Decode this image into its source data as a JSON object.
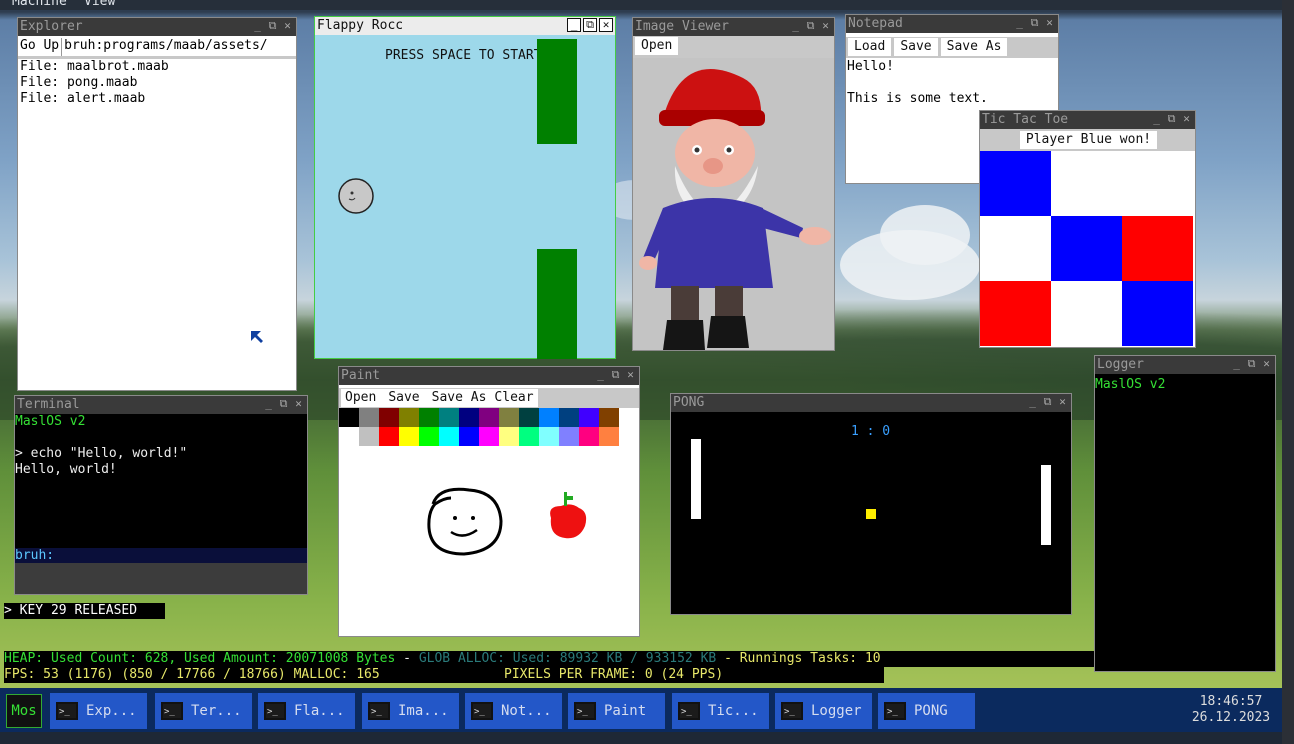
{
  "menu": {
    "machine": "Machine",
    "view": "View"
  },
  "explorer": {
    "title": "Explorer",
    "go_up": "Go Up",
    "path": "bruh:programs/maab/assets/",
    "files": [
      "File: maalbrot.maab",
      "File: pong.maab",
      "File: alert.maab"
    ]
  },
  "flappy": {
    "title": "Flappy Rocc",
    "prompt": "PRESS SPACE TO START"
  },
  "image_viewer": {
    "title": "Image Viewer",
    "open": "Open"
  },
  "notepad": {
    "title": "Notepad",
    "load": "Load",
    "save": "Save",
    "save_as": "Save As",
    "line1": "Hello!",
    "line2": "This is some text."
  },
  "tictactoe": {
    "title": "Tic Tac Toe",
    "status": "Player Blue won!",
    "board": [
      "blue",
      "white",
      "white",
      "white",
      "blue",
      "red",
      "red",
      "white",
      "blue"
    ],
    "colors": {
      "blue": "#0000ff",
      "red": "#ff0000",
      "white": "#ffffff"
    }
  },
  "terminal": {
    "title": "Terminal",
    "header": "MaslOS v2",
    "command": "> echo \"Hello, world!\"",
    "output": "Hello, world!",
    "prompt": "bruh:"
  },
  "key_event": "> KEY 29 RELEASED",
  "paint": {
    "title": "Paint",
    "open": "Open",
    "save": "Save",
    "save_as": "Save As",
    "clear": "Clear",
    "palette_row1": [
      "#000000",
      "#808080",
      "#800000",
      "#808000",
      "#008000",
      "#008080",
      "#000080",
      "#800080",
      "#808040",
      "#004040",
      "#0080ff",
      "#004080",
      "#4000ff",
      "#804000"
    ],
    "palette_row2": [
      "#ffffff",
      "#c0c0c0",
      "#ff0000",
      "#ffff00",
      "#00ff00",
      "#00ffff",
      "#0000ff",
      "#ff00ff",
      "#ffff80",
      "#00ff80",
      "#80ffff",
      "#8080ff",
      "#ff0080",
      "#ff8040"
    ]
  },
  "pong": {
    "title": "PONG",
    "score": "1 : 0"
  },
  "logger": {
    "title": "Logger",
    "line": "MaslOS v2"
  },
  "status": {
    "heap": "HEAP: Used Count: 628, Used Amount: 20071008 Bytes",
    "dash1": " - ",
    "glob": "GLOB ALLOC: Used: 89932 KB / 933152 KB",
    "tasks": " - Runnings Tasks: 10",
    "fps": "FPS: 53 (1176) (850 / 17766 / 18766)  MALLOC: 165",
    "pixels": "PIXELS PER FRAME: 0 (24 PPS)"
  },
  "taskbar": {
    "logo": "Mos",
    "tasks": [
      "Exp...",
      "Ter...",
      "Fla...",
      "Ima...",
      "Not...",
      "Paint",
      "Tic...",
      "Logger",
      "PONG"
    ],
    "time": "18:46:57",
    "date": "26.12.2023"
  }
}
